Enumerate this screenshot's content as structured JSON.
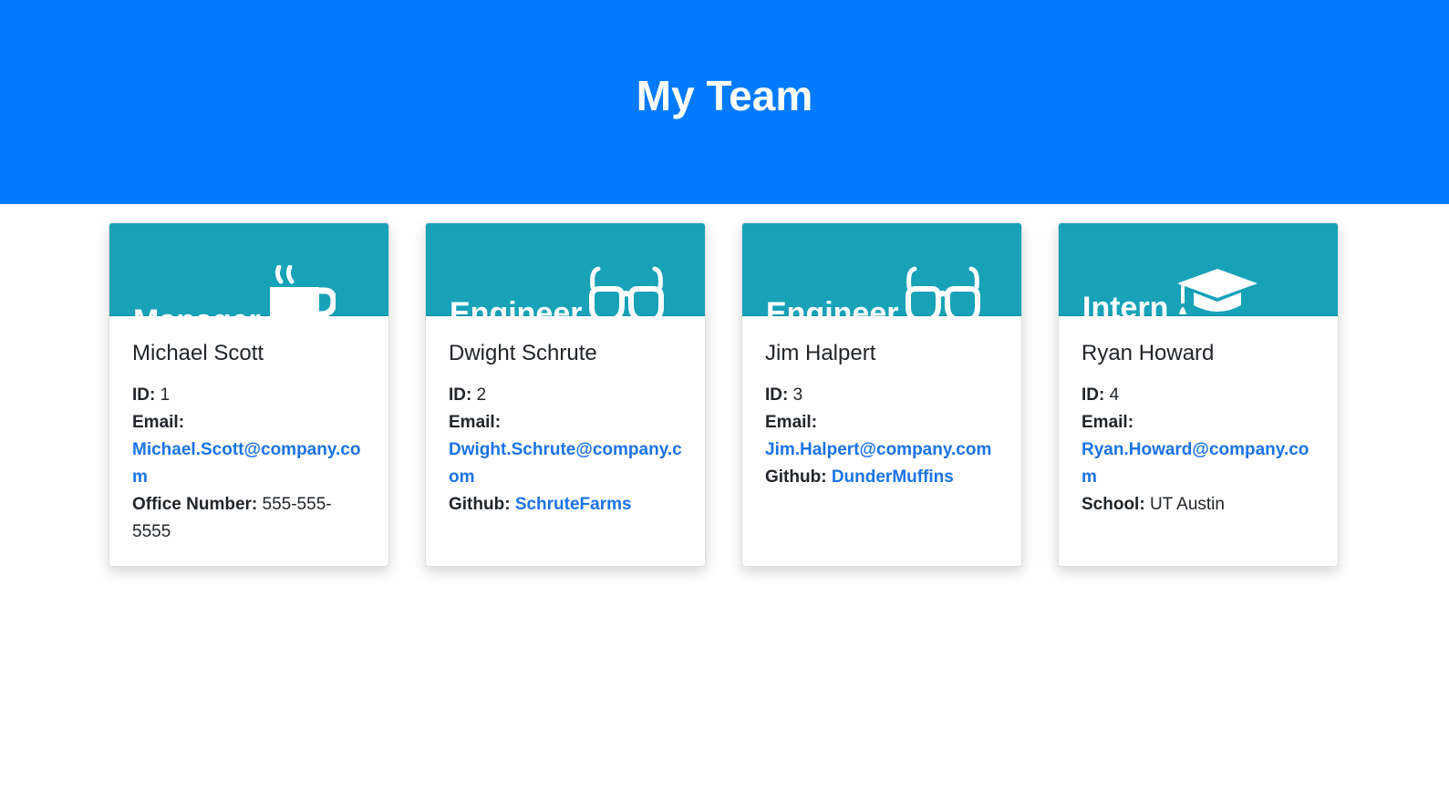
{
  "header": {
    "title": "My Team"
  },
  "cards": [
    {
      "role": "Manager",
      "icon": "coffee-mug-icon",
      "name": "Michael Scott",
      "id_label": "ID:",
      "id": "1",
      "email_label": "Email:",
      "email": "Michael.Scott@company.com",
      "extra_label": "Office Number:",
      "extra_value": "555-555-5555"
    },
    {
      "role": "Engineer",
      "icon": "glasses-icon",
      "name": "Dwight Schrute",
      "id_label": "ID:",
      "id": "2",
      "email_label": "Email:",
      "email": "Dwight.Schrute@company.com",
      "extra_label": "Github:",
      "extra_value": "SchruteFarms"
    },
    {
      "role": "Engineer",
      "icon": "glasses-icon",
      "name": "Jim Halpert",
      "id_label": "ID:",
      "id": "3",
      "email_label": "Email:",
      "email": "Jim.Halpert@company.com",
      "extra_label": "Github:",
      "extra_value": "DunderMuffins"
    },
    {
      "role": "Intern",
      "icon": "graduation-cap-icon",
      "name": "Ryan Howard",
      "id_label": "ID:",
      "id": "4",
      "email_label": "Email:",
      "email": "Ryan.Howard@company.com",
      "extra_label": "School:",
      "extra_value": "UT Austin"
    }
  ],
  "colors": {
    "header_bg": "#007bff",
    "card_header_bg": "#17a2b8",
    "link": "#1a73e8"
  }
}
